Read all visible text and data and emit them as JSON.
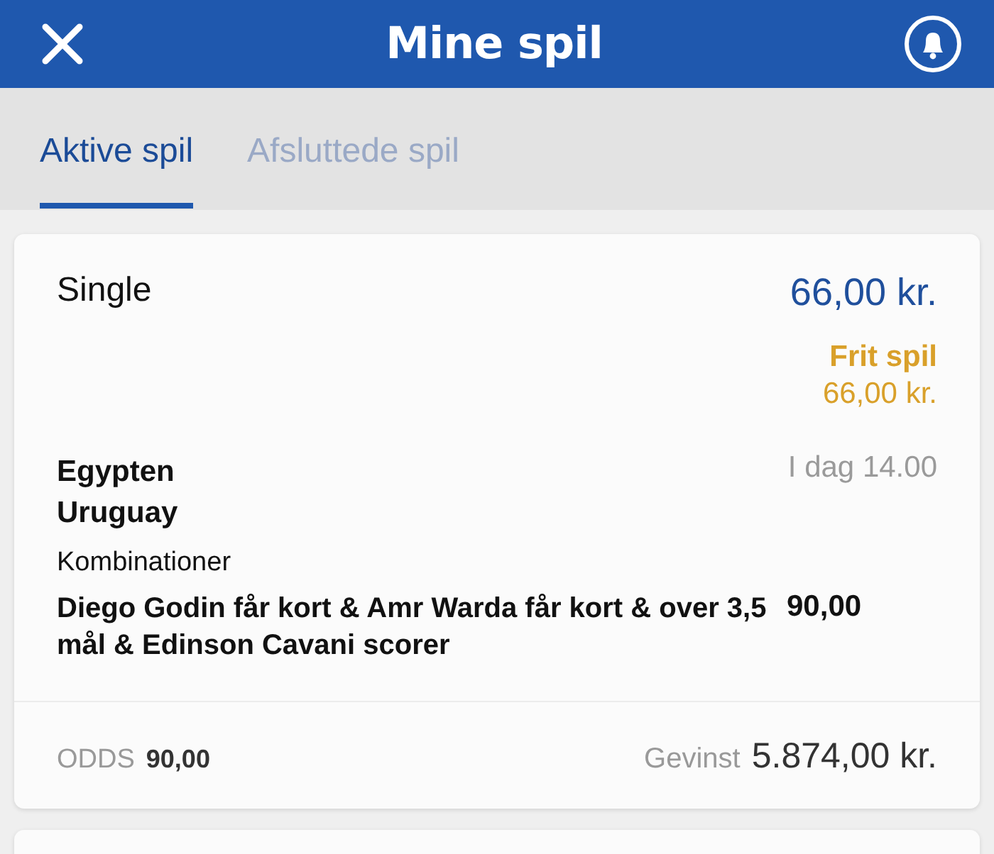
{
  "header": {
    "title": "Mine spil"
  },
  "tabs": [
    {
      "label": "Aktive spil",
      "selected": true
    },
    {
      "label": "Afsluttede spil",
      "selected": false
    }
  ],
  "bets": [
    {
      "type": "Single",
      "stake": "66,00 kr.",
      "free_bet": {
        "label": "Frit spil",
        "amount": "66,00 kr."
      },
      "teams": [
        "Egypten",
        "Uruguay"
      ],
      "time": "I dag 14.00",
      "selection_label": "Kombinationer",
      "selection": "Diego Godin får kort & Amr Warda får kort & over 3,5 mål & Edinson Cavani scorer",
      "selection_odds": "90,00",
      "odds_label": "ODDS",
      "odds": "90,00",
      "win_label": "Gevinst",
      "win": "5.874,00 kr."
    }
  ]
}
